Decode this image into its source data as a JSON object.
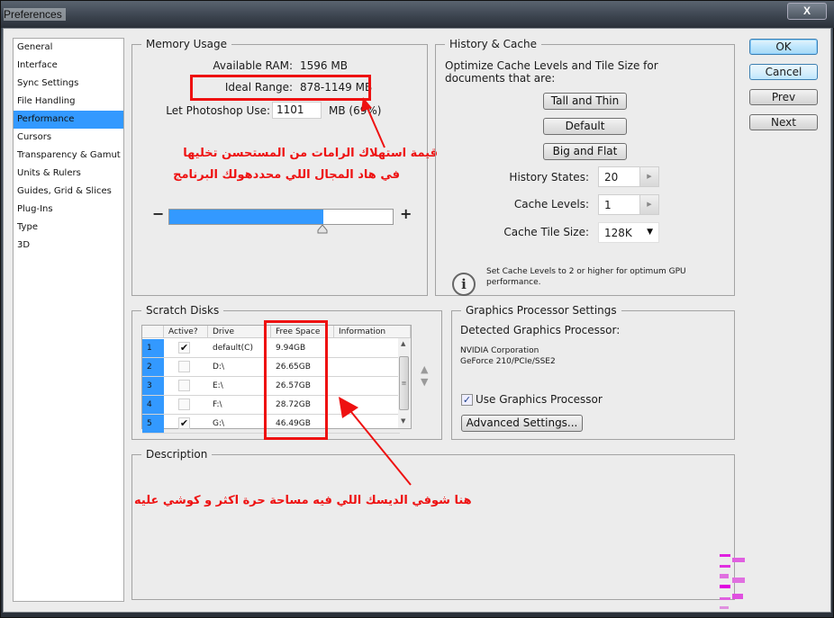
{
  "window": {
    "title": "Preferences",
    "close_label": "X"
  },
  "sidebar": {
    "items": [
      {
        "label": "General",
        "active": false
      },
      {
        "label": "Interface",
        "active": false
      },
      {
        "label": "Sync Settings",
        "active": false
      },
      {
        "label": "File Handling",
        "active": false
      },
      {
        "label": "Performance",
        "active": true
      },
      {
        "label": "Cursors",
        "active": false
      },
      {
        "label": "Transparency & Gamut",
        "active": false
      },
      {
        "label": "Units & Rulers",
        "active": false
      },
      {
        "label": "Guides, Grid & Slices",
        "active": false
      },
      {
        "label": "Plug-Ins",
        "active": false
      },
      {
        "label": "Type",
        "active": false
      },
      {
        "label": "3D",
        "active": false
      }
    ]
  },
  "memory": {
    "title": "Memory Usage",
    "available_label": "Available RAM:",
    "available_value": "1596 MB",
    "ideal_label": "Ideal Range:",
    "ideal_value": "878-1149 MB",
    "use_label": "Let Photoshop Use:",
    "use_value": "1101",
    "use_suffix": "MB (69%)",
    "slider_percent": 69,
    "minus": "−",
    "plus": "+"
  },
  "annotations": {
    "ram_note_line1": "قيمة استهلاك الرامات من المستحسن تخليها",
    "ram_note_line2": "في هاد المجال اللي محددهولك البرنامج",
    "disk_note": "هنا شوفي الديسك اللي فيه مساحة حرة اكثر و كوشي عليه",
    "color": "#ee1111"
  },
  "history_cache": {
    "title": "History & Cache",
    "description": "Optimize Cache Levels and Tile Size for documents that are:",
    "buttons": [
      "Tall and Thin",
      "Default",
      "Big and Flat"
    ],
    "history_states_label": "History States:",
    "history_states_value": "20",
    "cache_levels_label": "Cache Levels:",
    "cache_levels_value": "1",
    "tile_size_label": "Cache Tile Size:",
    "tile_size_value": "128K",
    "info_text": "Set Cache Levels to 2 or higher for optimum GPU performance."
  },
  "dialog_buttons": {
    "ok": "OK",
    "cancel": "Cancel",
    "prev": "Prev",
    "next": "Next"
  },
  "scratch_disks": {
    "title": "Scratch Disks",
    "columns": [
      "",
      "Active?",
      "Drive",
      "Free Space",
      "Information"
    ],
    "rows": [
      {
        "num": "1",
        "active": true,
        "drive": "default(C)",
        "free": "9.94GB",
        "info": ""
      },
      {
        "num": "2",
        "active": false,
        "drive": "D:\\",
        "free": "26.65GB",
        "info": ""
      },
      {
        "num": "3",
        "active": false,
        "drive": "E:\\",
        "free": "26.57GB",
        "info": ""
      },
      {
        "num": "4",
        "active": false,
        "drive": "F:\\",
        "free": "28.72GB",
        "info": ""
      },
      {
        "num": "5",
        "active": true,
        "drive": "G:\\",
        "free": "46.49GB",
        "info": ""
      }
    ]
  },
  "gpu": {
    "title": "Graphics Processor Settings",
    "detected_label": "Detected Graphics Processor:",
    "vendor": "NVIDIA Corporation",
    "model": "GeForce 210/PCIe/SSE2",
    "use_gpu_label": "Use Graphics Processor",
    "use_gpu_checked": true,
    "advanced_label": "Advanced Settings..."
  },
  "description": {
    "title": "Description"
  },
  "colors": {
    "selection": "#3399ff",
    "annotation_red": "#ee1111",
    "dialog_bg": "#ececec"
  }
}
